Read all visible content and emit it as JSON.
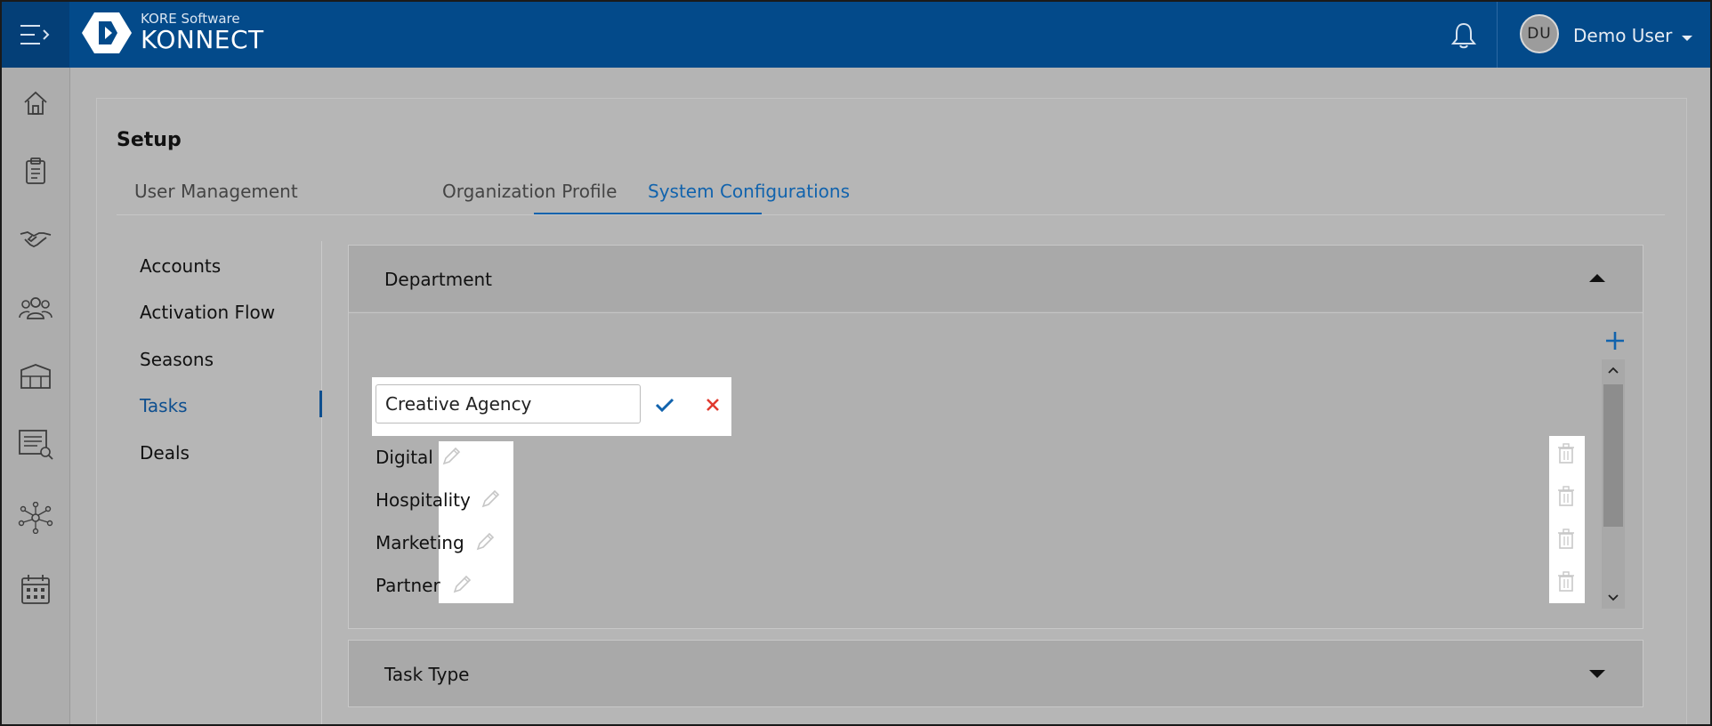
{
  "brand": {
    "company": "KORE Software",
    "product": "KONNECT"
  },
  "user": {
    "initials": "DU",
    "name": "Demo User"
  },
  "page": {
    "title": "Setup"
  },
  "tabs": [
    {
      "label": "User Management"
    },
    {
      "label": "Organization Profile"
    },
    {
      "label": "System Configurations"
    }
  ],
  "sidenav": [
    {
      "label": "Accounts"
    },
    {
      "label": "Activation Flow"
    },
    {
      "label": "Seasons"
    },
    {
      "label": "Tasks"
    },
    {
      "label": "Deals"
    }
  ],
  "department": {
    "title": "Department",
    "editing_value": "Creative Agency",
    "items": [
      {
        "label": "Digital"
      },
      {
        "label": "Hospitality"
      },
      {
        "label": "Marketing"
      },
      {
        "label": "Partner"
      }
    ]
  },
  "task_type": {
    "title": "Task Type"
  },
  "colors": {
    "topbar": "#034a8a",
    "accent": "#1163ad",
    "cancel": "#e03a2f"
  },
  "icons": {
    "menu": "menu-expand-icon",
    "notifications": "bell-icon",
    "rail": [
      "home-icon",
      "clipboard-icon",
      "handshake-icon",
      "people-icon",
      "venue-icon",
      "report-search-icon",
      "network-icon",
      "calendar-icon"
    ]
  }
}
